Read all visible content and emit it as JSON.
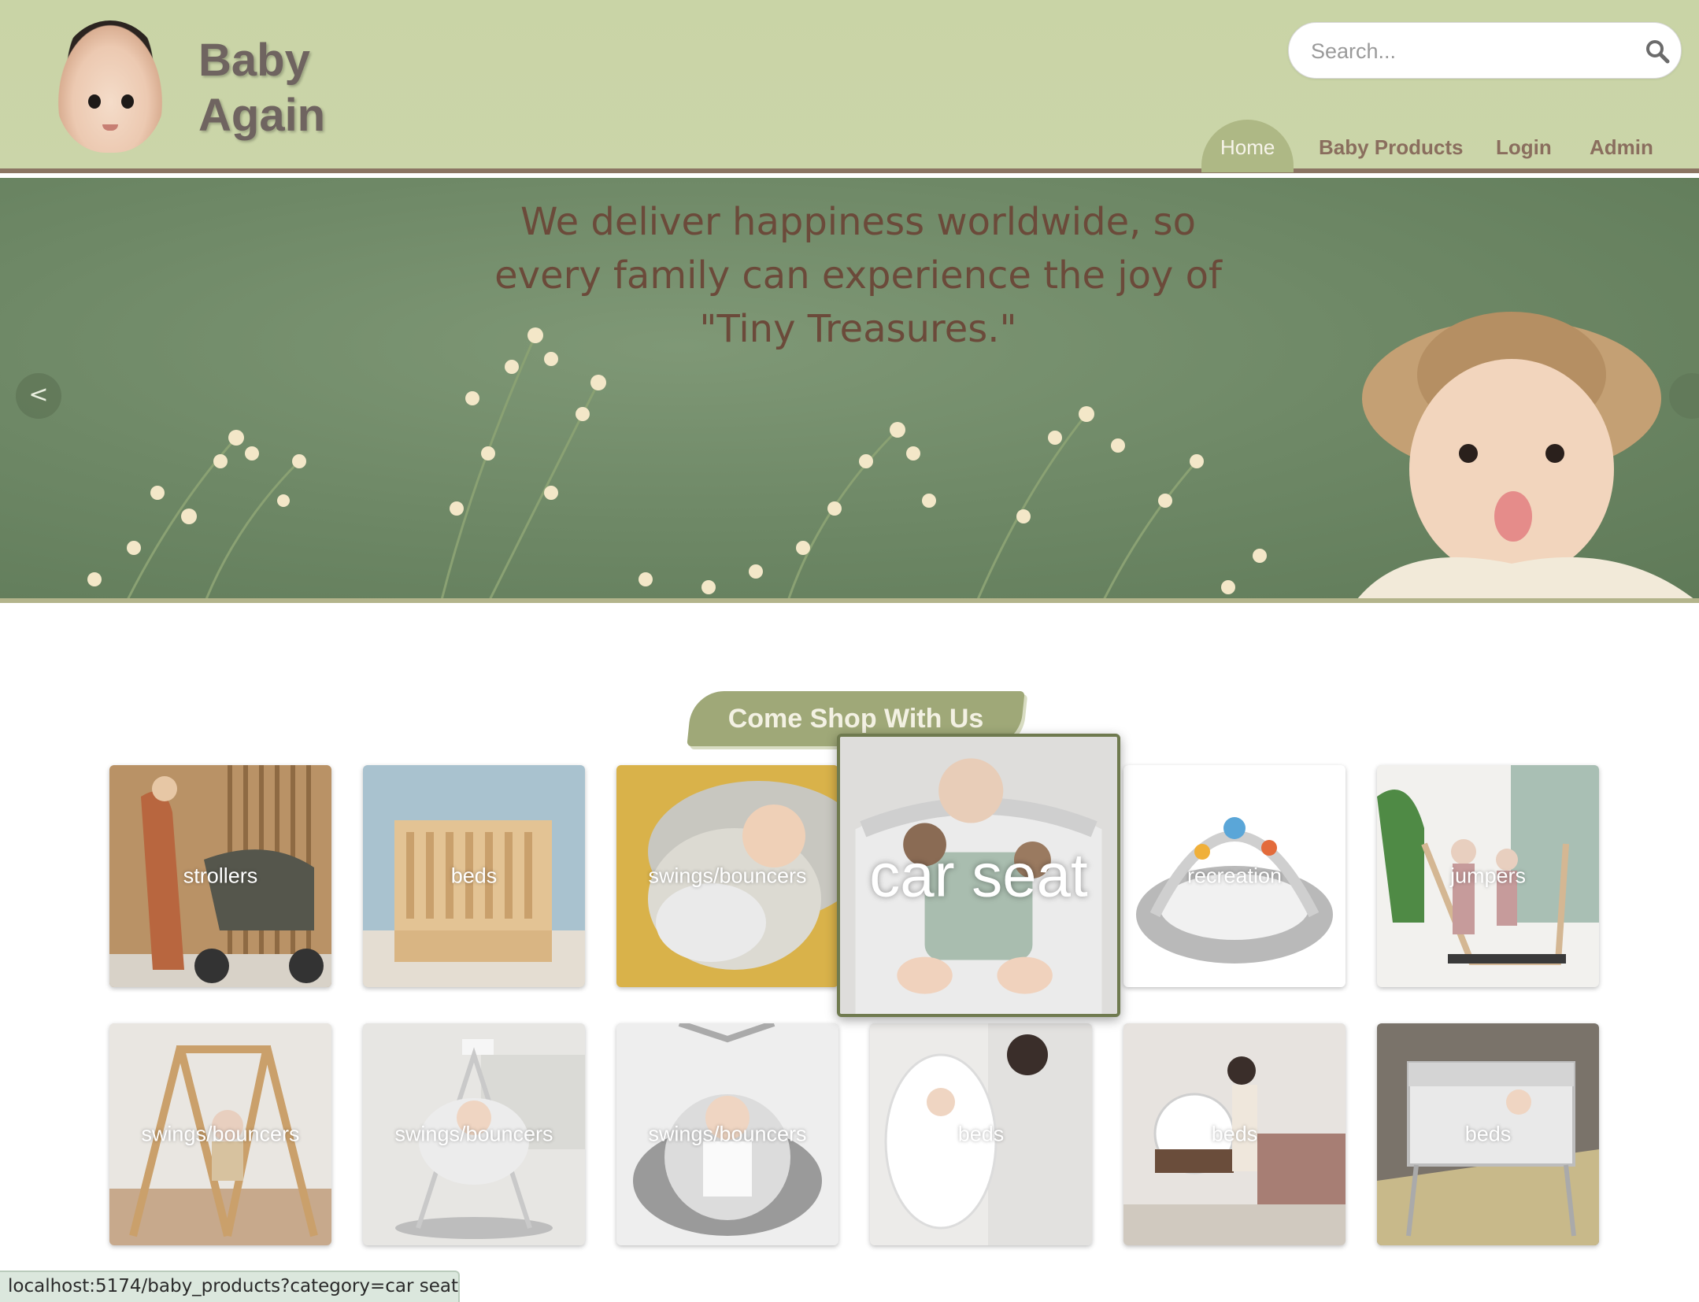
{
  "brand": {
    "line1": "Baby",
    "line2": "Again"
  },
  "search": {
    "placeholder": "Search..."
  },
  "nav": {
    "home": "Home",
    "baby_products": "Baby Products",
    "login": "Login",
    "admin": "Admin"
  },
  "hero": {
    "line1": "We deliver happiness worldwide, so",
    "line2": "every family can experience the joy of",
    "line3": "\"Tiny Treasures.\"",
    "prev": "<"
  },
  "shop": {
    "title": "Come Shop With Us",
    "tiles": [
      {
        "label": "strollers"
      },
      {
        "label": "beds"
      },
      {
        "label": "swings/bouncers"
      },
      {
        "label": "car seat"
      },
      {
        "label": "recreation"
      },
      {
        "label": "jumpers"
      },
      {
        "label": "swings/bouncers"
      },
      {
        "label": "swings/bouncers"
      },
      {
        "label": "swings/bouncers"
      },
      {
        "label": "beds"
      },
      {
        "label": "beds"
      },
      {
        "label": "beds"
      }
    ]
  },
  "status": {
    "url": "localhost:5174/baby_products?category=car seat"
  },
  "colors": {
    "header_bg": "#cbd5a9",
    "nav_text": "#8a6e5e",
    "nav_active_bg": "#aeb885",
    "hero_bg": "#6e8866",
    "hero_text": "#6b4a3a",
    "shop_title_bg": "#9fa878",
    "tile_hover_border": "#6f7a4f"
  }
}
